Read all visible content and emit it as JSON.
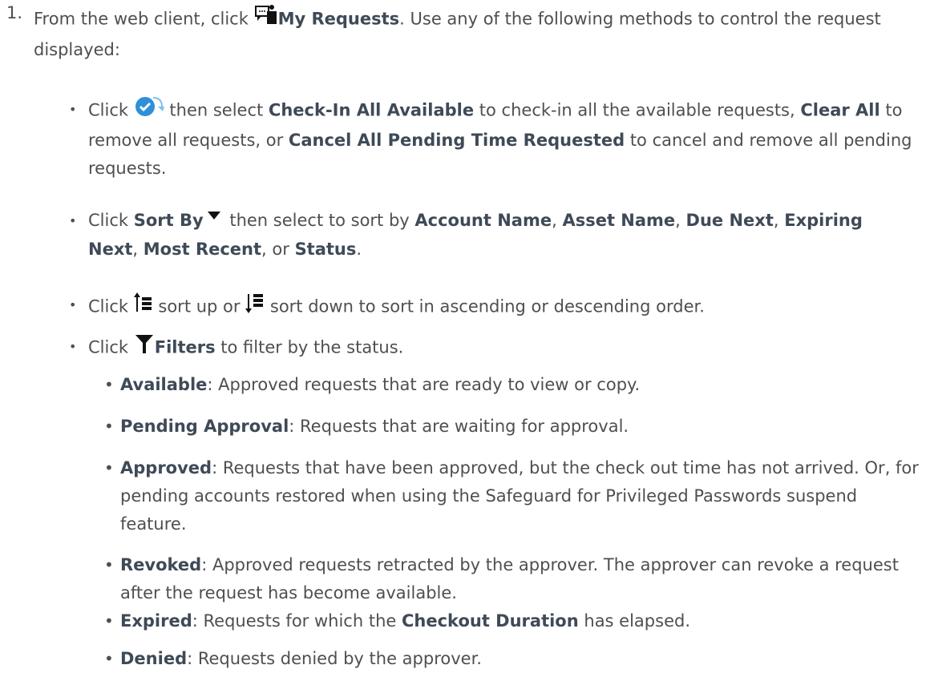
{
  "step": {
    "number": "1.",
    "t1": "From the web client, click ",
    "my_requests": "My Requests",
    "t2": ". Use any of the following methods to control the request displayed:"
  },
  "bullets": {
    "b1": {
      "t1": "Click ",
      "t2": " then select ",
      "check_in": "Check-In All Available",
      "t3": " to check-in all the available requests, ",
      "clear_all": "Clear All",
      "t4": " to remove all requests, or ",
      "cancel_all": "Cancel All Pending Time Requested",
      "t5": " to cancel and remove all pending requests."
    },
    "b2": {
      "t1": "Click ",
      "sort_by": "Sort By",
      "t2": " then select to sort by ",
      "account_name": "Account Name",
      "c1": ", ",
      "asset_name": "Asset Name",
      "c2": ", ",
      "due_next": "Due Next",
      "c3": ", ",
      "expiring_next": "Expiring Next",
      "c4": ", ",
      "most_recent": "Most Recent",
      "c5": ", or ",
      "status": "Status",
      "t3": "."
    },
    "b3": {
      "t1": "Click ",
      "t2": " sort up or ",
      "t3": " sort down to sort in ascending or descending order."
    },
    "b4": {
      "t1": "Click ",
      "filters": "Filters",
      "t2": " to filter by the status."
    }
  },
  "statuses": [
    {
      "name": "Available",
      "desc": ": Approved requests that are ready to view or copy."
    },
    {
      "name": "Pending Approval",
      "desc": ": Requests that are waiting for approval."
    },
    {
      "name": "Approved",
      "desc": ": Requests that have been approved, but the check out time has not arrived. Or, for pending accounts restored when using the Safeguard for Privileged Passwords suspend feature."
    },
    {
      "name": "Revoked",
      "desc": ": Approved requests retracted by the approver. The approver can revoke a request after the request has become available."
    },
    {
      "name": "Expired",
      "desc_pre": ": Requests for which the ",
      "strong": "Checkout Duration",
      "desc_post": " has elapsed."
    },
    {
      "name": "Denied",
      "desc": ": Requests denied by the approver."
    }
  ],
  "colors": {
    "text": "#4f4f4f",
    "bold": "#3f4a57",
    "check_icon_blue": "#2f8fd8",
    "icon_dark": "#111111"
  },
  "icons": [
    "my-requests-icon",
    "check-in-icon",
    "sort-by-caret-icon",
    "sort-up-icon",
    "sort-down-icon",
    "filter-icon"
  ]
}
